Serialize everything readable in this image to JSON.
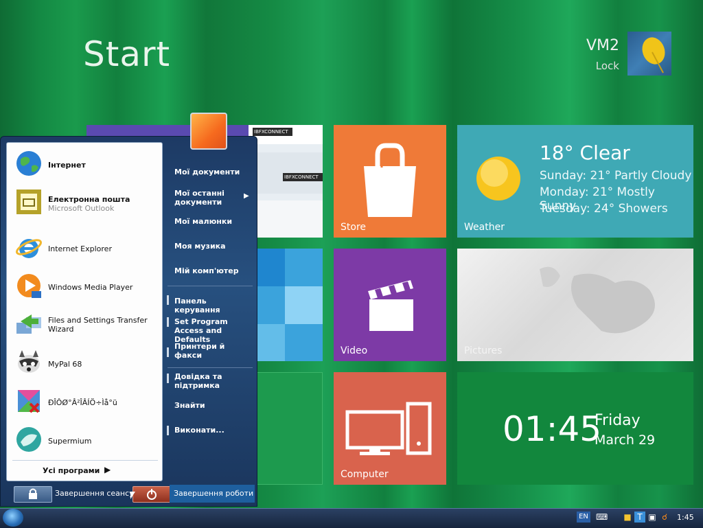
{
  "start": {
    "title": "Start"
  },
  "user": {
    "name": "VM2",
    "lock_label": "Lock"
  },
  "tiles": {
    "store": {
      "label": "Store"
    },
    "weather": {
      "label": "Weather",
      "current": "18° Clear",
      "forecast": [
        "Sunday: 21° Partly Cloudy",
        "Monday: 21° Mostly Sunny",
        "Tuesday: 24° Showers"
      ]
    },
    "video": {
      "label": "Video"
    },
    "pictures": {
      "label": "Pictures"
    },
    "computer": {
      "label": "Computer"
    },
    "clock": {
      "time": "01:45",
      "day": "Friday",
      "date": "March 29"
    },
    "browser_preview": {
      "badge": "IBFXCONNECT"
    }
  },
  "start_menu": {
    "programs": [
      {
        "label": "Інтернет",
        "bold": true,
        "icon": "globe-icon"
      },
      {
        "label": "Електронна пошта",
        "sub": "Microsoft Outlook",
        "bold": true,
        "icon": "outlook-icon"
      },
      {
        "label": "Internet Explorer",
        "icon": "ie-icon"
      },
      {
        "label": "Windows Media Player",
        "icon": "media-player-icon"
      },
      {
        "label": "Files and Settings Transfer Wizard",
        "icon": "transfer-wizard-icon"
      },
      {
        "label": "MyPal 68",
        "icon": "raccoon-icon"
      },
      {
        "label": "ÐÎÔØ°Â²ÎÂÍÖ÷Ìå°ü",
        "icon": "broken-app-icon"
      },
      {
        "label": "Supermium",
        "icon": "bird-icon"
      }
    ],
    "all_programs": "Усі програми",
    "right_links": [
      "Мої документи",
      "Мої останні документи",
      "Мої малюнки",
      "Моя музика",
      "Мій комп'ютер",
      "Панель керування",
      "Set Program Access and Defaults",
      "Принтери й факси",
      "Довідка та підтримка",
      "Знайти",
      "Виконати..."
    ],
    "logoff_label": "Завершення сеансу",
    "shutdown_label": "Завершення роботи"
  },
  "taskbar": {
    "language": "EN",
    "time": "1:45"
  }
}
